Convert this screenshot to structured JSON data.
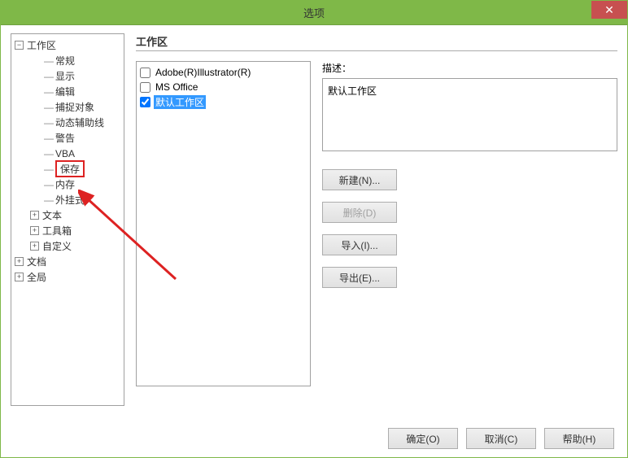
{
  "window": {
    "title": "选项"
  },
  "tree": {
    "root": {
      "label": "工作区",
      "expanded": true
    },
    "items": [
      {
        "label": "常规"
      },
      {
        "label": "显示"
      },
      {
        "label": "编辑"
      },
      {
        "label": "捕捉对象"
      },
      {
        "label": "动态辅助线"
      },
      {
        "label": "警告"
      },
      {
        "label": "VBA"
      },
      {
        "label": "保存",
        "highlighted": true
      },
      {
        "label": "内存"
      },
      {
        "label": "外挂式"
      },
      {
        "label": "文本",
        "expandable": true
      },
      {
        "label": "工具箱",
        "expandable": true
      },
      {
        "label": "自定义",
        "expandable": true
      }
    ],
    "siblings": [
      {
        "label": "文档",
        "expandable": true
      },
      {
        "label": "全局",
        "expandable": true
      }
    ]
  },
  "main": {
    "section_title": "工作区",
    "list": [
      {
        "label": "Adobe(R)Illustrator(R)",
        "checked": false,
        "selected": false
      },
      {
        "label": "MS Office",
        "checked": false,
        "selected": false
      },
      {
        "label": "默认工作区",
        "checked": true,
        "selected": true
      }
    ],
    "desc_label": "描述：",
    "desc_value": "默认工作区",
    "buttons": {
      "new": "新建(N)...",
      "delete": "删除(D)",
      "import": "导入(I)...",
      "export": "导出(E)..."
    }
  },
  "footer": {
    "ok": "确定(O)",
    "cancel": "取消(C)",
    "help": "帮助(H)"
  }
}
